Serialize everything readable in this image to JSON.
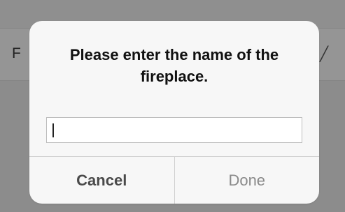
{
  "background": {
    "row_text": "F",
    "row_edit_icon": "pencil-icon"
  },
  "dialog": {
    "title": "Please enter the name of the fireplace.",
    "input_value": "",
    "input_placeholder": "",
    "cancel_label": "Cancel",
    "done_label": "Done"
  },
  "colors": {
    "dialog_background": "#f7f7f7",
    "overlay": "#8c8c8c",
    "cancel_text": "#4a4a4a",
    "done_text_disabled": "#8a8a8a"
  }
}
